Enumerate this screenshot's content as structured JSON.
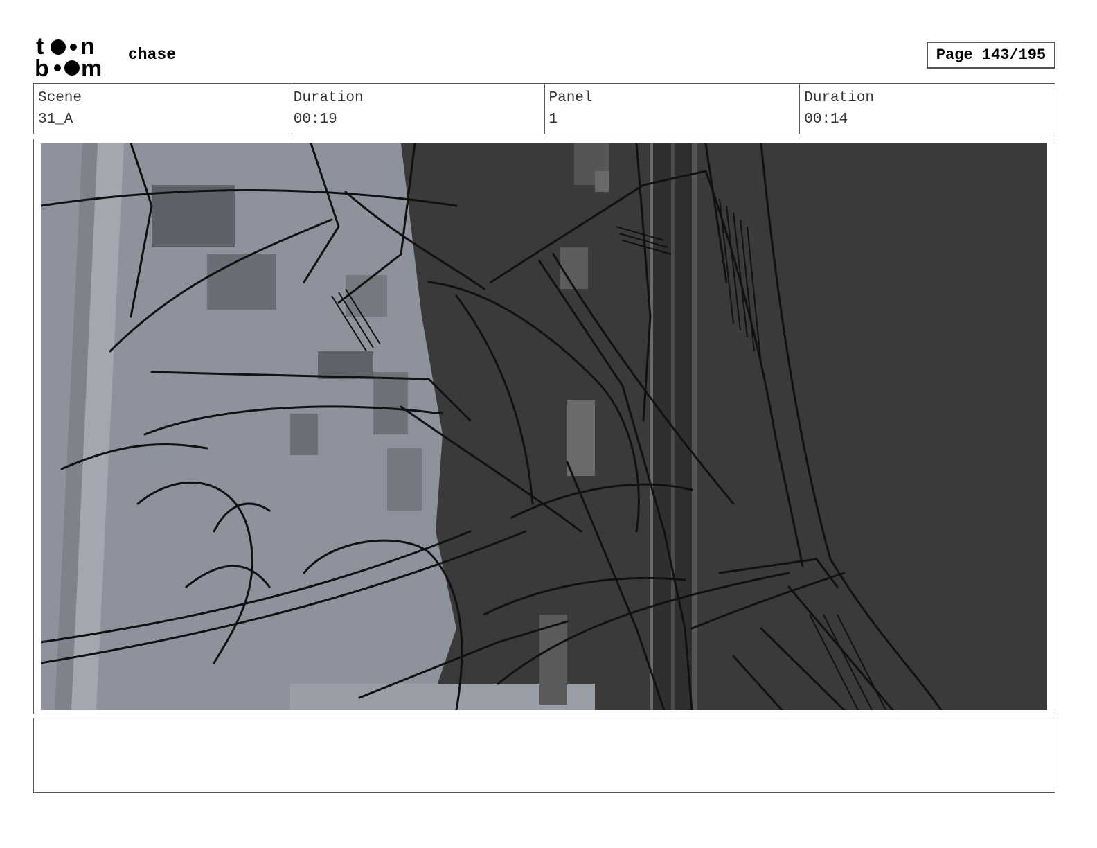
{
  "header": {
    "logo_text": "toon boom",
    "project_title": "chase",
    "page_label": "Page 143/195"
  },
  "info": {
    "scene_label": "Scene",
    "scene_value": "31_A",
    "scene_duration_label": "Duration",
    "scene_duration_value": "00:19",
    "panel_label": "Panel",
    "panel_value": "1",
    "panel_duration_label": "Duration",
    "panel_duration_value": "00:14"
  },
  "panel": {
    "image_icon": "storyboard-sketch",
    "colors": {
      "light_bg": "#8e929c",
      "dark_bg": "#3a3a3a",
      "line": "#111111"
    }
  },
  "notes": {
    "text": ""
  }
}
